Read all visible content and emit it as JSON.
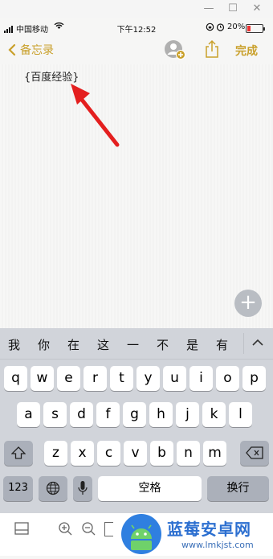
{
  "window": {
    "minimize": "—",
    "maximize": "☐",
    "close": "✕"
  },
  "status": {
    "carrier": "中国移动",
    "time": "下午12:52",
    "battery": "20%"
  },
  "nav": {
    "back_label": "备忘录",
    "done_label": "完成"
  },
  "note": {
    "text": "{百度经验}"
  },
  "keyboard": {
    "candidates": [
      "我",
      "你",
      "在",
      "这",
      "一",
      "不",
      "是",
      "有"
    ],
    "row1": [
      "q",
      "w",
      "e",
      "r",
      "t",
      "y",
      "u",
      "i",
      "o",
      "p"
    ],
    "row2": [
      "a",
      "s",
      "d",
      "f",
      "g",
      "h",
      "j",
      "k",
      "l"
    ],
    "row3": [
      "z",
      "x",
      "c",
      "v",
      "b",
      "n",
      "m"
    ],
    "numbers_label": "123",
    "space_label": "空格",
    "return_label": "换行"
  },
  "watermark": {
    "brand": "蓝莓安卓网",
    "url": "www.lmkjst.com"
  }
}
